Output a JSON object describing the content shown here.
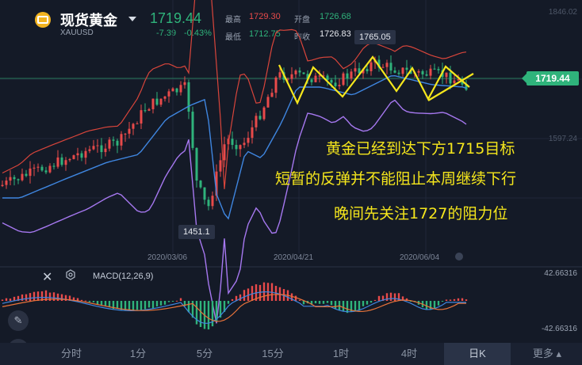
{
  "header": {
    "title": "现货黄金",
    "symbol": "XAUUSD",
    "price": "1719.44",
    "change": "-7.39",
    "change_pct": "-0.43%",
    "high_label": "最高",
    "high": "1729.30",
    "low_label": "最低",
    "low": "1712.75",
    "open_label": "开盘",
    "open": "1726.68",
    "prev_close_label": "昨收",
    "prev_close": "1726.83"
  },
  "chart": {
    "price_tag": "1719.44",
    "peak_label": "1765.05",
    "trough_label": "1451.1",
    "axis_labels": [
      "1846.02",
      "1597.24",
      "42.66316",
      "-42.66316"
    ],
    "dates": [
      "2020/03/06",
      "2020/04/21",
      "2020/06/04"
    ],
    "annotations": [
      "黄金已经到达下方1715目标",
      "短暂的反弹并不能阻止本周继续下行",
      "晚间先关注1727的阻力位"
    ],
    "macd_label": "MACD(12,26,9)"
  },
  "tabs": [
    {
      "label": "分时",
      "active": false
    },
    {
      "label": "1分",
      "active": false
    },
    {
      "label": "5分",
      "active": false
    },
    {
      "label": "15分",
      "active": false
    },
    {
      "label": "1时",
      "active": false
    },
    {
      "label": "4时",
      "active": false
    },
    {
      "label": "日K",
      "active": true
    },
    {
      "label": "更多 ▴",
      "active": false
    }
  ],
  "colors": {
    "up": "#e84a4a",
    "down": "#2fb37b",
    "annotation": "#f5e61c",
    "boll_upper": "#d9453b",
    "boll_mid": "#3f86e0",
    "boll_lower": "#a678f0"
  },
  "icons": [
    "gold-bar-icon",
    "close-icon",
    "settings-icon",
    "pencil-icon",
    "indicator-icon"
  ]
}
